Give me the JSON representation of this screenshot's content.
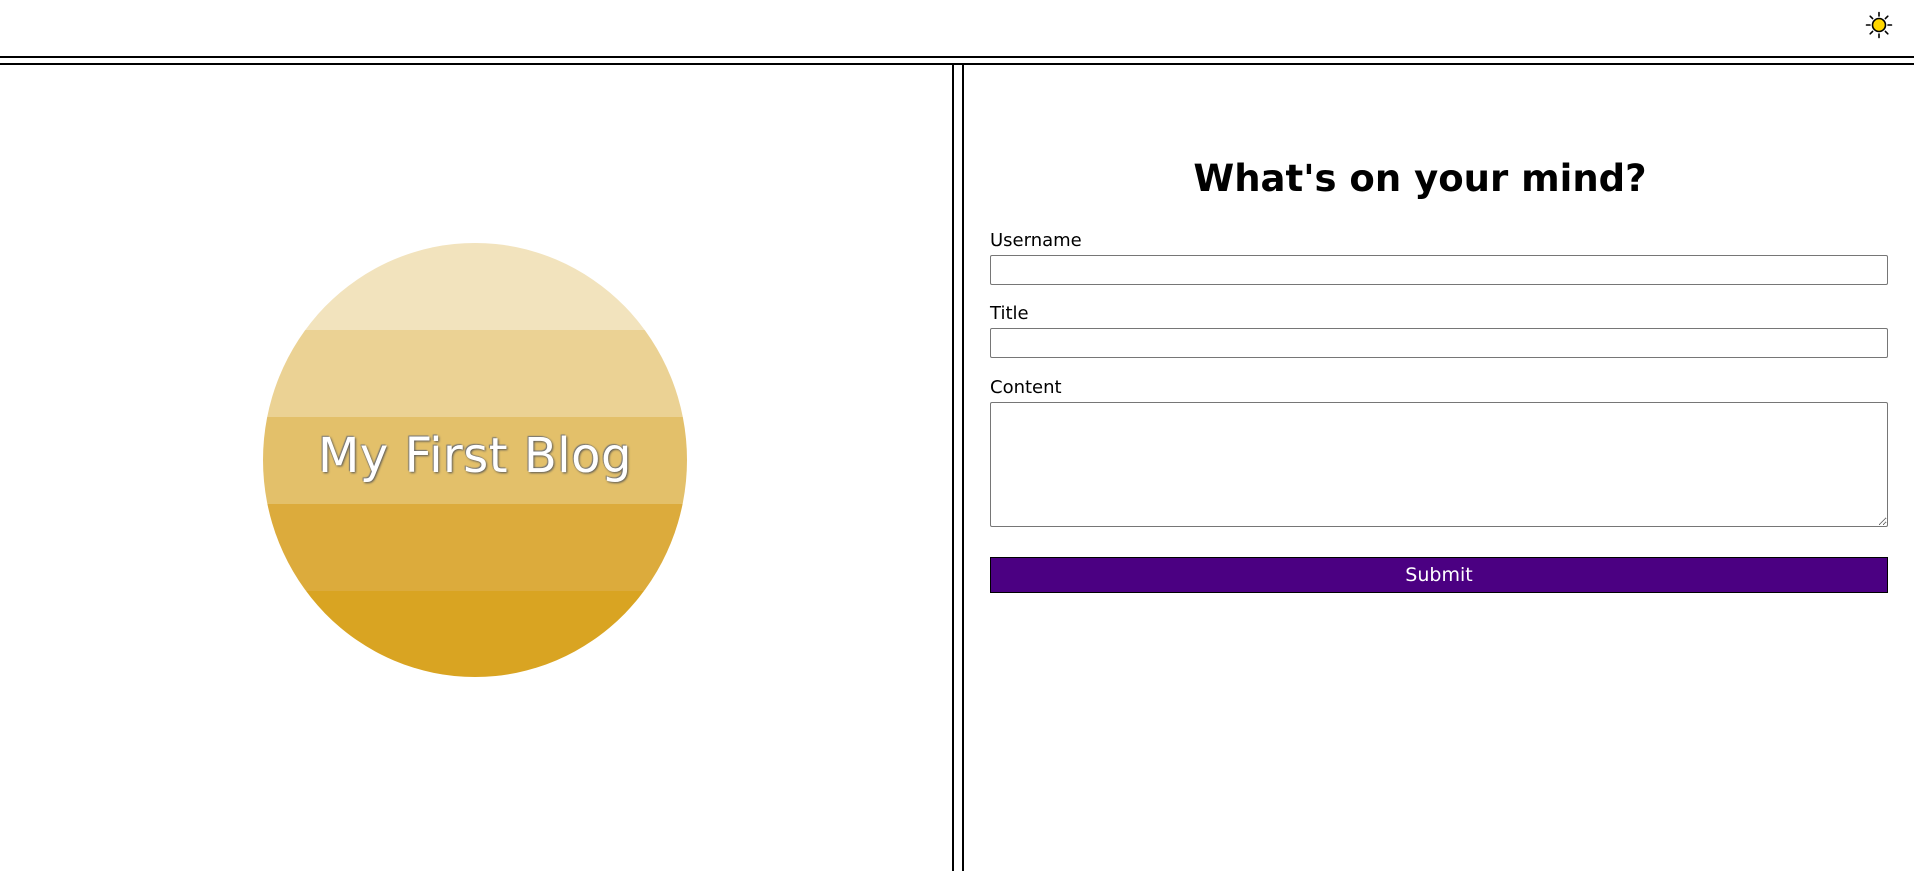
{
  "header": {
    "theme_toggle_icon": "sun-icon",
    "theme_toggle_color": "#ffd700"
  },
  "blog": {
    "title": "My First Blog",
    "badge_colors": [
      "#f2e3bd",
      "#ebd294",
      "#e3c06a",
      "#dcab3c",
      "#d9a422"
    ]
  },
  "form": {
    "heading": "What's on your mind?",
    "username_label": "Username",
    "username_value": "",
    "title_label": "Title",
    "title_value": "",
    "content_label": "Content",
    "content_value": "",
    "submit_label": "Submit",
    "submit_color": "#4b0082"
  }
}
